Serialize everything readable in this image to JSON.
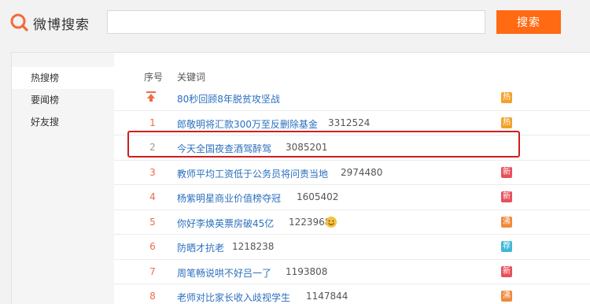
{
  "header": {
    "logo_text": "微博搜索",
    "search_placeholder": "",
    "search_button_label": "搜索"
  },
  "sidebar": {
    "items": [
      {
        "label": "热搜榜",
        "active": true
      },
      {
        "label": "要闻榜",
        "active": false
      },
      {
        "label": "好友搜",
        "active": false
      }
    ]
  },
  "table": {
    "headers": {
      "rank": "序号",
      "keyword": "关键词"
    },
    "rows": [
      {
        "rank": "",
        "pinned": true,
        "keyword": "80秒回顾8年脱贫攻坚战",
        "count": "",
        "badge": "热",
        "badge_color": "#f3a12a"
      },
      {
        "rank": "1",
        "keyword": "郎敬明将汇款300万至反删除基金",
        "count": "3312524",
        "badge": "热",
        "badge_color": "#f3a12a"
      },
      {
        "rank": "2",
        "keyword": "今天全国夜查酒驾醉驾",
        "count": "3085201",
        "badge": "",
        "badge_color": ""
      },
      {
        "rank": "3",
        "keyword": "教师平均工资低于公务员将问责当地",
        "count": "2974480",
        "badge": "新",
        "badge_color": "#e8505b"
      },
      {
        "rank": "4",
        "keyword": "杨紫明星商业价值榜夺冠",
        "count": "1605402",
        "badge": "新",
        "badge_color": "#e8505b"
      },
      {
        "rank": "5",
        "keyword": "你好李焕英票房破45亿",
        "count": "1223968",
        "badge": "沸",
        "badge_color": "#f08a3c",
        "emoji": true
      },
      {
        "rank": "6",
        "keyword": "防晒才抗老",
        "count": "1218238",
        "badge": "荐",
        "badge_color": "#3fb8d8"
      },
      {
        "rank": "7",
        "keyword": "周笔畅说哄不好吕一了",
        "count": "1193808",
        "badge": "新",
        "badge_color": "#e8505b"
      },
      {
        "rank": "8",
        "keyword": "老师对比家长收入歧视学生",
        "count": "1147844",
        "badge": "沸",
        "badge_color": "#f08a3c"
      }
    ]
  },
  "colors": {
    "accent": "#ff6a12",
    "link": "#2b6fbf",
    "rank": "#f06a4a",
    "highlight_box": "#cc1f1f"
  }
}
